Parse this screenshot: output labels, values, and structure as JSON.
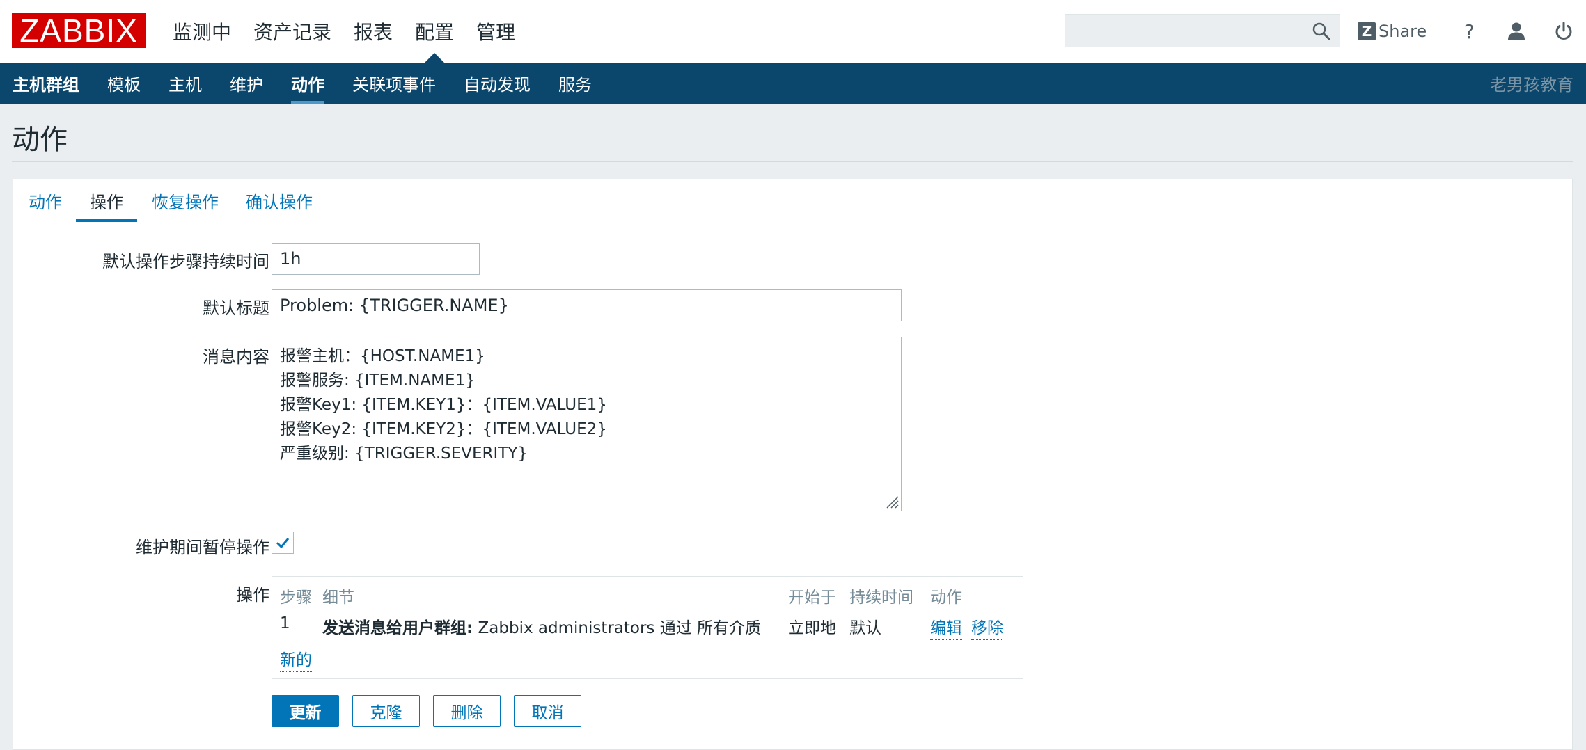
{
  "header": {
    "logo": "ZABBIX",
    "main_menu": [
      "监测中",
      "资产记录",
      "报表",
      "配置",
      "管理"
    ],
    "active_menu": "配置",
    "search": {
      "placeholder": ""
    },
    "share_label": "Share",
    "help_label": "?"
  },
  "subnav": {
    "items": [
      "主机群组",
      "模板",
      "主机",
      "维护",
      "动作",
      "关联项事件",
      "自动发现",
      "服务"
    ],
    "active": "动作",
    "brand": "老男孩教育"
  },
  "page": {
    "title": "动作"
  },
  "tabs": {
    "items": [
      "动作",
      "操作",
      "恢复操作",
      "确认操作"
    ],
    "active": "操作"
  },
  "form": {
    "step_duration": {
      "label": "默认操作步骤持续时间",
      "value": "1h"
    },
    "subject": {
      "label": "默认标题",
      "value": "Problem: {TRIGGER.NAME}"
    },
    "message": {
      "label": "消息内容",
      "lines": [
        "报警主机：{HOST.NAME1}",
        "报警服务: {ITEM.NAME1}",
        "报警Key1: {ITEM.KEY1}：{ITEM.VALUE1}",
        "报警Key2: {ITEM.KEY2}：{ITEM.VALUE2}",
        "严重级别: {TRIGGER.SEVERITY}"
      ]
    },
    "pause": {
      "label": "维护期间暂停操作",
      "checked": true
    },
    "operations": {
      "label": "操作",
      "headers": [
        "步骤",
        "细节",
        "开始于",
        "持续时间",
        "动作"
      ],
      "rows": [
        {
          "step": "1",
          "detail_bold": "发送消息给用户群组:",
          "detail_rest": " Zabbix administrators 通过 所有介质",
          "start": "立即地",
          "duration": "默认",
          "edit": "编辑",
          "remove": "移除"
        }
      ],
      "new_label": "新的"
    },
    "buttons": {
      "update": "更新",
      "clone": "克隆",
      "delete": "删除",
      "cancel": "取消"
    }
  },
  "colors": {
    "nav_bg": "#0b476c",
    "link": "#0275b8",
    "logo_bg": "#d40000"
  }
}
